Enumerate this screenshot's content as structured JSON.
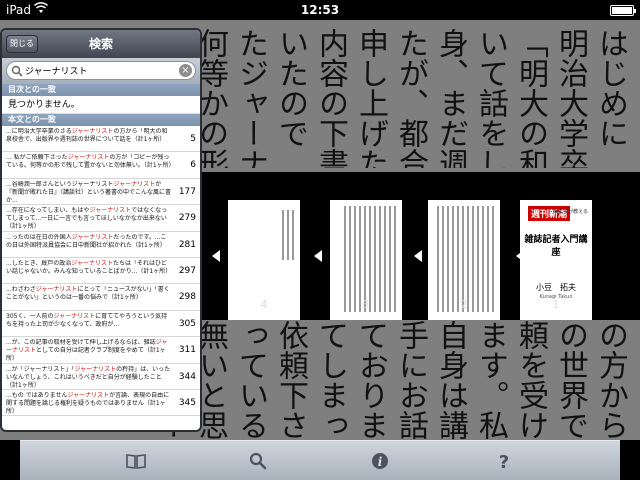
{
  "status": {
    "device": "iPad",
    "time": "12:53"
  },
  "page": {
    "top_columns": [
      "はじめに",
      "明治大学卒",
      "「明大の和泉校",
      "いて話をして",
      "身、まだ週刊",
      "たが、都合八",
      "申し上げた様",
      "内容の下書き",
      "いたので",
      "たジャーナリ",
      "何等かの形で",
      "んだと"
    ],
    "bottom_columns": [
      "の方から",
      "の世界で",
      "頼を受けた",
      "ます。私自",
      "自身は講演",
      "手にお話を",
      "ております",
      "てしまって",
      "依頼下さっ",
      "っている。",
      "無いと思う",
      "のコピーを"
    ]
  },
  "thumbnails": [
    {
      "num": "1",
      "brand": "週刊新潮",
      "subtitle": "編集長が教える",
      "title": "雑誌記者入門講座",
      "author": "小豆　拓夫",
      "author_en": "Kunagi Takuo"
    },
    {
      "num": "2"
    },
    {
      "num": "3"
    },
    {
      "num": "4"
    }
  ],
  "popover": {
    "close_label": "閉じる",
    "title": "検索",
    "search_value": "ジャーナリスト",
    "toc_header": "目次との一致",
    "not_found": "見つかりません。",
    "body_header": "本文との一致",
    "results": [
      {
        "before": "...に明治大学卒業のさる",
        "hit": "ジャーナリスト",
        "after": "の方から「明大の和泉校舎で、出版界や週刊誌の世界について話を（計1ヶ所）",
        "page": "5"
      },
      {
        "before": "... 私がご依頼下さった",
        "hit": "ジャーナリスト",
        "after": "の方が「コピーが残っている。何等かの形で残して置かないと勿体無い。（計1ヶ所）",
        "page": "6"
      },
      {
        "before": "...谷崎潤一郎さんというジャーナリスト",
        "hit": "ジャーナリスト",
        "after": "が『新聞が敗れた日』（講談社）という著書の中でこんな風に書か...",
        "page": "177"
      },
      {
        "before": "...存在になってしまい、もはや",
        "hit": "ジャーナリスト",
        "after": "ではなくなってしまって...一日に一言でも言ってほしいなかなか出来ない（計1ヶ所）",
        "page": "279"
      },
      {
        "before": "...ったのは在日の外国人",
        "hit": "ジャーナリスト",
        "after": "だったのです。...この日は外国特派員協会に日中新聞社が招かれた（計1ヶ所）",
        "page": "281"
      },
      {
        "before": "...したとき、厩戸の政治",
        "hit": "ジャーナリスト",
        "after": "たちは「それはひどい話じゃないか。みんな知っていることばかり...（計1ヶ所）",
        "page": "297"
      },
      {
        "before": "...わざわざ",
        "hit": "ジャーナリスト",
        "after": "にとって「ニュースがない」「書くことがない」というのは一番の悩みで（計1ヶ所）",
        "page": "298"
      },
      {
        "before": "305く、一人前の",
        "hit": "ジャーナリスト",
        "after": "に育ててやろうという気持ちを持った上司が少なくなって、政府が...",
        "page": "305"
      },
      {
        "before": "...が、この記事の取材を受けて伸し上げるならば、雑誌",
        "hit": "ジャーナリスト",
        "after": "としての自分は記者クラブ制度をやめて（計1ヶ所）",
        "page": "311"
      },
      {
        "before": "...が「ジャーナリスト」「",
        "hit": "ジャーナリスト",
        "after": "の矜持」は、いったいなんでしょう、これはいうべきだと自分が経験したこと（計1ヶ所）",
        "page": "344"
      },
      {
        "before": "...もの ではありません",
        "hit": "ジャーナリスト",
        "after": "が言論、表現の自由に関する問題を論じる権利を疑うものではありません（計1ヶ所）",
        "page": "345"
      }
    ]
  },
  "icons": {
    "toc": "book-icon",
    "search": "search-icon",
    "info": "info-icon",
    "help": "help-icon"
  }
}
